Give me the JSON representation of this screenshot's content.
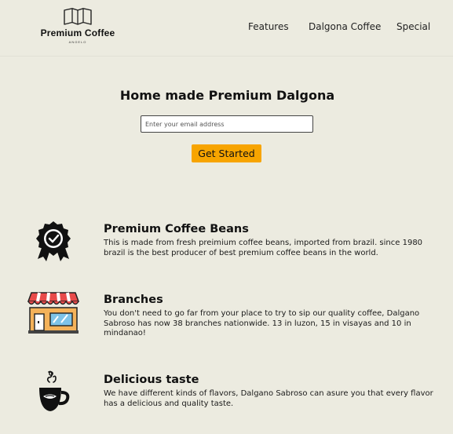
{
  "brand": {
    "name": "Premium Coffee",
    "tagline": "ANGELO"
  },
  "nav": {
    "items": [
      "Features",
      "Dalgona Coffee",
      "Special"
    ]
  },
  "hero": {
    "title": "Home made Premium Dalgona",
    "email_placeholder": "Enter your email address",
    "cta_label": "Get Started"
  },
  "features": [
    {
      "icon": "badge-check-icon",
      "title": "Premium Coffee Beans",
      "description": "This is made from fresh preimium coffee beans, imported from brazil. since 1980 brazil is the best producer of best premium coffee beans in the world."
    },
    {
      "icon": "store-icon",
      "title": "Branches",
      "description": "You don't need to go far from your place to try to sip our quality coffee, Dalgano Sabroso has now 38 branches nationwide. 13 in luzon, 15 in visayas and 10 in mindanao!"
    },
    {
      "icon": "coffee-cup-icon",
      "title": "Delicious taste",
      "description": "We have different kinds of flavors, Dalgano Sabroso can asure you that every flavor has a delicious and quality taste."
    }
  ],
  "colors": {
    "background": "#ecebe0",
    "accent": "#f7a400"
  }
}
